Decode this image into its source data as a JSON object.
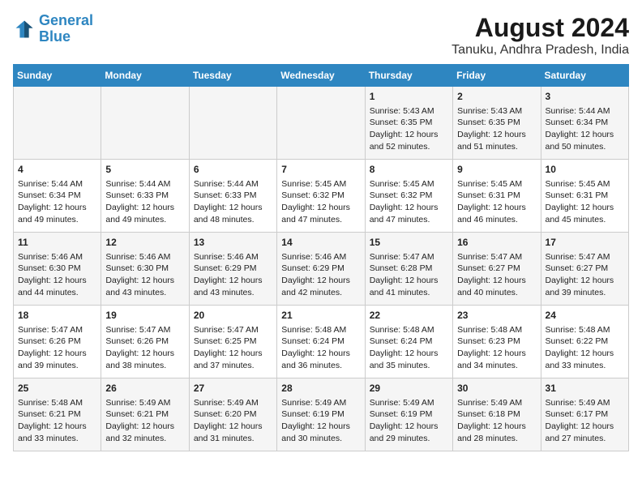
{
  "header": {
    "logo_line1": "General",
    "logo_line2": "Blue",
    "main_title": "August 2024",
    "subtitle": "Tanuku, Andhra Pradesh, India"
  },
  "days_of_week": [
    "Sunday",
    "Monday",
    "Tuesday",
    "Wednesday",
    "Thursday",
    "Friday",
    "Saturday"
  ],
  "weeks": [
    [
      {
        "day": "",
        "content": ""
      },
      {
        "day": "",
        "content": ""
      },
      {
        "day": "",
        "content": ""
      },
      {
        "day": "",
        "content": ""
      },
      {
        "day": "1",
        "content": "Sunrise: 5:43 AM\nSunset: 6:35 PM\nDaylight: 12 hours\nand 52 minutes."
      },
      {
        "day": "2",
        "content": "Sunrise: 5:43 AM\nSunset: 6:35 PM\nDaylight: 12 hours\nand 51 minutes."
      },
      {
        "day": "3",
        "content": "Sunrise: 5:44 AM\nSunset: 6:34 PM\nDaylight: 12 hours\nand 50 minutes."
      }
    ],
    [
      {
        "day": "4",
        "content": "Sunrise: 5:44 AM\nSunset: 6:34 PM\nDaylight: 12 hours\nand 49 minutes."
      },
      {
        "day": "5",
        "content": "Sunrise: 5:44 AM\nSunset: 6:33 PM\nDaylight: 12 hours\nand 49 minutes."
      },
      {
        "day": "6",
        "content": "Sunrise: 5:44 AM\nSunset: 6:33 PM\nDaylight: 12 hours\nand 48 minutes."
      },
      {
        "day": "7",
        "content": "Sunrise: 5:45 AM\nSunset: 6:32 PM\nDaylight: 12 hours\nand 47 minutes."
      },
      {
        "day": "8",
        "content": "Sunrise: 5:45 AM\nSunset: 6:32 PM\nDaylight: 12 hours\nand 47 minutes."
      },
      {
        "day": "9",
        "content": "Sunrise: 5:45 AM\nSunset: 6:31 PM\nDaylight: 12 hours\nand 46 minutes."
      },
      {
        "day": "10",
        "content": "Sunrise: 5:45 AM\nSunset: 6:31 PM\nDaylight: 12 hours\nand 45 minutes."
      }
    ],
    [
      {
        "day": "11",
        "content": "Sunrise: 5:46 AM\nSunset: 6:30 PM\nDaylight: 12 hours\nand 44 minutes."
      },
      {
        "day": "12",
        "content": "Sunrise: 5:46 AM\nSunset: 6:30 PM\nDaylight: 12 hours\nand 43 minutes."
      },
      {
        "day": "13",
        "content": "Sunrise: 5:46 AM\nSunset: 6:29 PM\nDaylight: 12 hours\nand 43 minutes."
      },
      {
        "day": "14",
        "content": "Sunrise: 5:46 AM\nSunset: 6:29 PM\nDaylight: 12 hours\nand 42 minutes."
      },
      {
        "day": "15",
        "content": "Sunrise: 5:47 AM\nSunset: 6:28 PM\nDaylight: 12 hours\nand 41 minutes."
      },
      {
        "day": "16",
        "content": "Sunrise: 5:47 AM\nSunset: 6:27 PM\nDaylight: 12 hours\nand 40 minutes."
      },
      {
        "day": "17",
        "content": "Sunrise: 5:47 AM\nSunset: 6:27 PM\nDaylight: 12 hours\nand 39 minutes."
      }
    ],
    [
      {
        "day": "18",
        "content": "Sunrise: 5:47 AM\nSunset: 6:26 PM\nDaylight: 12 hours\nand 39 minutes."
      },
      {
        "day": "19",
        "content": "Sunrise: 5:47 AM\nSunset: 6:26 PM\nDaylight: 12 hours\nand 38 minutes."
      },
      {
        "day": "20",
        "content": "Sunrise: 5:47 AM\nSunset: 6:25 PM\nDaylight: 12 hours\nand 37 minutes."
      },
      {
        "day": "21",
        "content": "Sunrise: 5:48 AM\nSunset: 6:24 PM\nDaylight: 12 hours\nand 36 minutes."
      },
      {
        "day": "22",
        "content": "Sunrise: 5:48 AM\nSunset: 6:24 PM\nDaylight: 12 hours\nand 35 minutes."
      },
      {
        "day": "23",
        "content": "Sunrise: 5:48 AM\nSunset: 6:23 PM\nDaylight: 12 hours\nand 34 minutes."
      },
      {
        "day": "24",
        "content": "Sunrise: 5:48 AM\nSunset: 6:22 PM\nDaylight: 12 hours\nand 33 minutes."
      }
    ],
    [
      {
        "day": "25",
        "content": "Sunrise: 5:48 AM\nSunset: 6:21 PM\nDaylight: 12 hours\nand 33 minutes."
      },
      {
        "day": "26",
        "content": "Sunrise: 5:49 AM\nSunset: 6:21 PM\nDaylight: 12 hours\nand 32 minutes."
      },
      {
        "day": "27",
        "content": "Sunrise: 5:49 AM\nSunset: 6:20 PM\nDaylight: 12 hours\nand 31 minutes."
      },
      {
        "day": "28",
        "content": "Sunrise: 5:49 AM\nSunset: 6:19 PM\nDaylight: 12 hours\nand 30 minutes."
      },
      {
        "day": "29",
        "content": "Sunrise: 5:49 AM\nSunset: 6:19 PM\nDaylight: 12 hours\nand 29 minutes."
      },
      {
        "day": "30",
        "content": "Sunrise: 5:49 AM\nSunset: 6:18 PM\nDaylight: 12 hours\nand 28 minutes."
      },
      {
        "day": "31",
        "content": "Sunrise: 5:49 AM\nSunset: 6:17 PM\nDaylight: 12 hours\nand 27 minutes."
      }
    ]
  ]
}
